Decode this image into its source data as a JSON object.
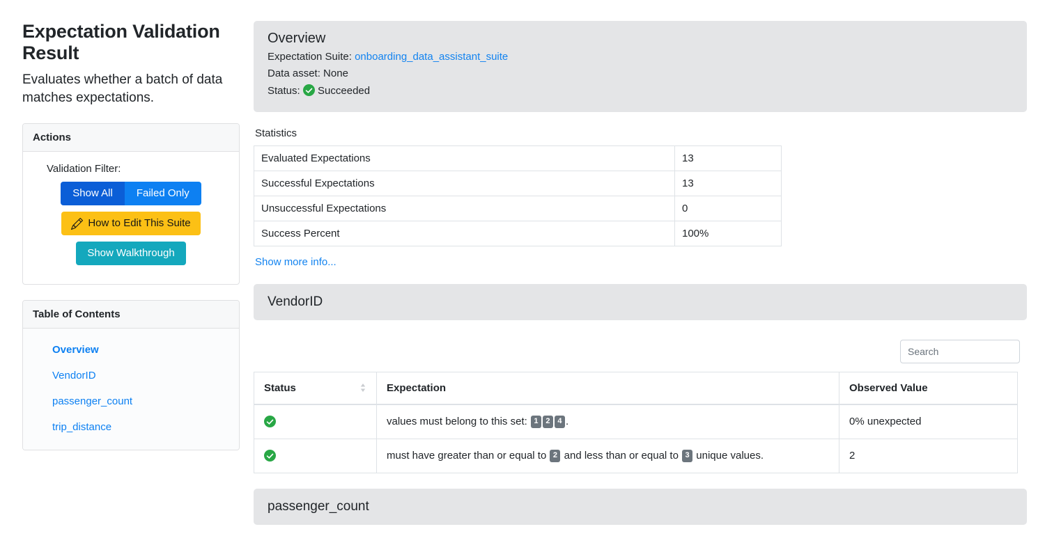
{
  "page": {
    "title": "Expectation Validation Result",
    "subtitle": "Evaluates whether a batch of data matches expectations."
  },
  "actions": {
    "header": "Actions",
    "filter_label": "Validation Filter:",
    "show_all_label": "Show All",
    "failed_only_label": "Failed Only",
    "edit_suite_label": "How to Edit This Suite",
    "walkthrough_label": "Show Walkthrough",
    "colors": {
      "show_all_bg": "#0b5ed7",
      "failed_only_bg": "#0d80f2",
      "edit_suite_bg": "#fcc015",
      "walkthrough_bg": "#14a8bd"
    }
  },
  "toc": {
    "header": "Table of Contents",
    "items": [
      {
        "label": "Overview",
        "active": true
      },
      {
        "label": "VendorID",
        "active": false
      },
      {
        "label": "passenger_count",
        "active": false
      },
      {
        "label": "trip_distance",
        "active": false
      }
    ]
  },
  "overview": {
    "title": "Overview",
    "suite_prefix": "Expectation Suite:",
    "suite_name": "onboarding_data_assistant_suite",
    "data_asset_prefix": "Data asset:",
    "data_asset_value": "None",
    "status_prefix": "Status:",
    "status_value": "Succeeded",
    "status_color": "#28a745",
    "panel_bg": "#e4e5e7"
  },
  "statistics": {
    "label": "Statistics",
    "rows": [
      {
        "key": "Evaluated Expectations",
        "value": "13"
      },
      {
        "key": "Successful Expectations",
        "value": "13"
      },
      {
        "key": "Unsuccessful Expectations",
        "value": "0"
      },
      {
        "key": "Success Percent",
        "value": "100%"
      }
    ],
    "show_more_label": "Show more info..."
  },
  "sections": [
    {
      "name": "VendorID",
      "search_placeholder": "Search",
      "columns": {
        "status": "Status",
        "expectation": "Expectation",
        "observed": "Observed Value"
      },
      "rows": [
        {
          "status": "success",
          "expectation_parts": [
            {
              "type": "text",
              "value": "values must belong to this set: "
            },
            {
              "type": "badge",
              "value": "1"
            },
            {
              "type": "badge",
              "value": "2"
            },
            {
              "type": "badge",
              "value": "4"
            },
            {
              "type": "text",
              "value": "."
            }
          ],
          "observed": "0% unexpected"
        },
        {
          "status": "success",
          "expectation_parts": [
            {
              "type": "text",
              "value": "must have greater than or equal to "
            },
            {
              "type": "badge",
              "value": "2"
            },
            {
              "type": "text",
              "value": " and less than or equal to "
            },
            {
              "type": "badge",
              "value": "3"
            },
            {
              "type": "text",
              "value": " unique values."
            }
          ],
          "observed": "2"
        }
      ]
    },
    {
      "name": "passenger_count"
    }
  ]
}
